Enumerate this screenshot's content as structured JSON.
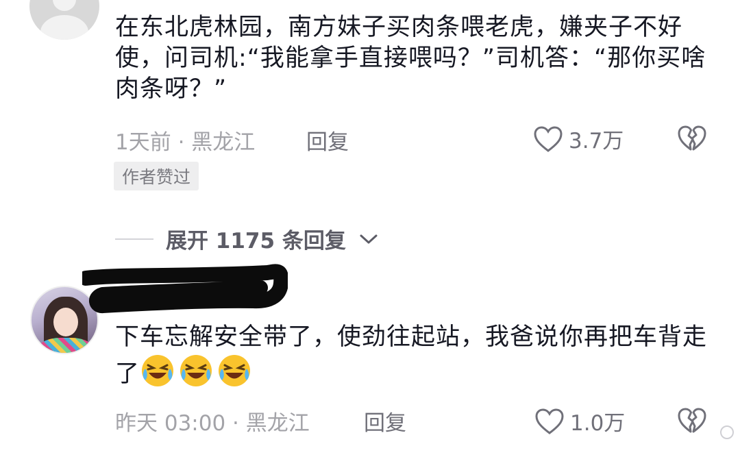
{
  "comments": [
    {
      "text": "在东北虎林园，南方妹子买肉条喂老虎，嫌夹子不好使，问司机:“我能拿手直接喂吗？”司机答：“那你买啥肉条呀？”",
      "meta": "1天前 · 黑龙江",
      "reply_label": "回复",
      "likes": "3.7万",
      "badge": "作者赞过"
    },
    {
      "text": "下车忘解安全带了，使劲往起站，我爸说你再把车背走了",
      "meta": "昨天 03:00 · 黑龙江",
      "reply_label": "回复",
      "likes": "1.0万"
    }
  ],
  "expand_replies": {
    "label": "展开 1175 条回复"
  },
  "icons": {
    "like": "heart-outline-icon",
    "dislike": "broken-heart-icon",
    "expand": "chevron-down-icon",
    "emoji": "laughing-crying-emoji"
  },
  "colors": {
    "text_primary": "#161823",
    "text_secondary": "#a3a3a8",
    "text_action": "#707079",
    "badge_bg": "#eeeeef"
  }
}
